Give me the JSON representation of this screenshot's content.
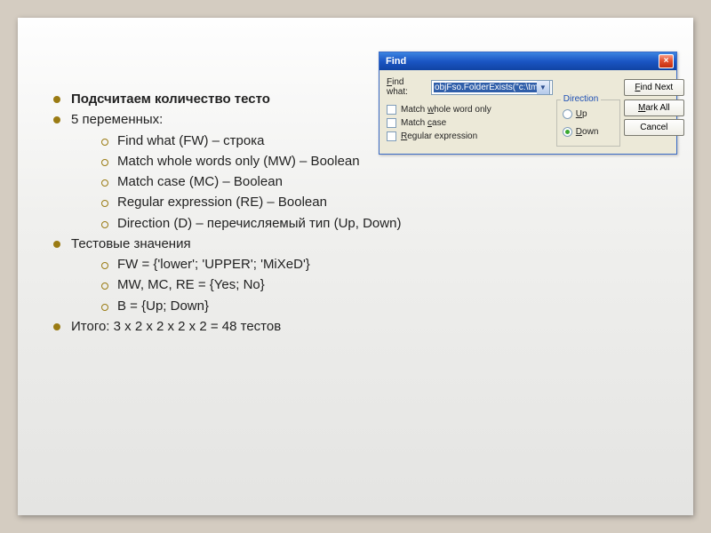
{
  "slide": {
    "b1": "Подсчитаем количество тесто",
    "b2": "5 переменных:",
    "s1": "Find what (FW) – строка",
    "s2": "Match whole words only (MW) – Boolean",
    "s3": "Match case (MC) – Boolean",
    "s4": "Regular expression (RE) – Boolean",
    "s5": "Direction (D) – перечисляемый тип (Up, Down)",
    "b3": "Тестовые значения",
    "t1": "FW = {'lower'; 'UPPER'; 'MiXeD'}",
    "t2": "MW, MC, RE = {Yes; No}",
    "t3": "В = {Up; Down}",
    "b4": "Итого: 3 x 2 x 2 x 2 x 2 = 48 тестов"
  },
  "dialog": {
    "title": "Find",
    "close": "×",
    "fw_label": "Find what:",
    "fw_value": "objFso.FolderExists(\"c:\\tmp\")",
    "chk1": "Match whole word only",
    "chk2": "Match case",
    "chk3": "Regular expression",
    "dir_legend": "Direction",
    "dir_up": "Up",
    "dir_down": "Down",
    "btn1": "Find Next",
    "btn2": "Mark All",
    "btn3": "Cancel"
  }
}
